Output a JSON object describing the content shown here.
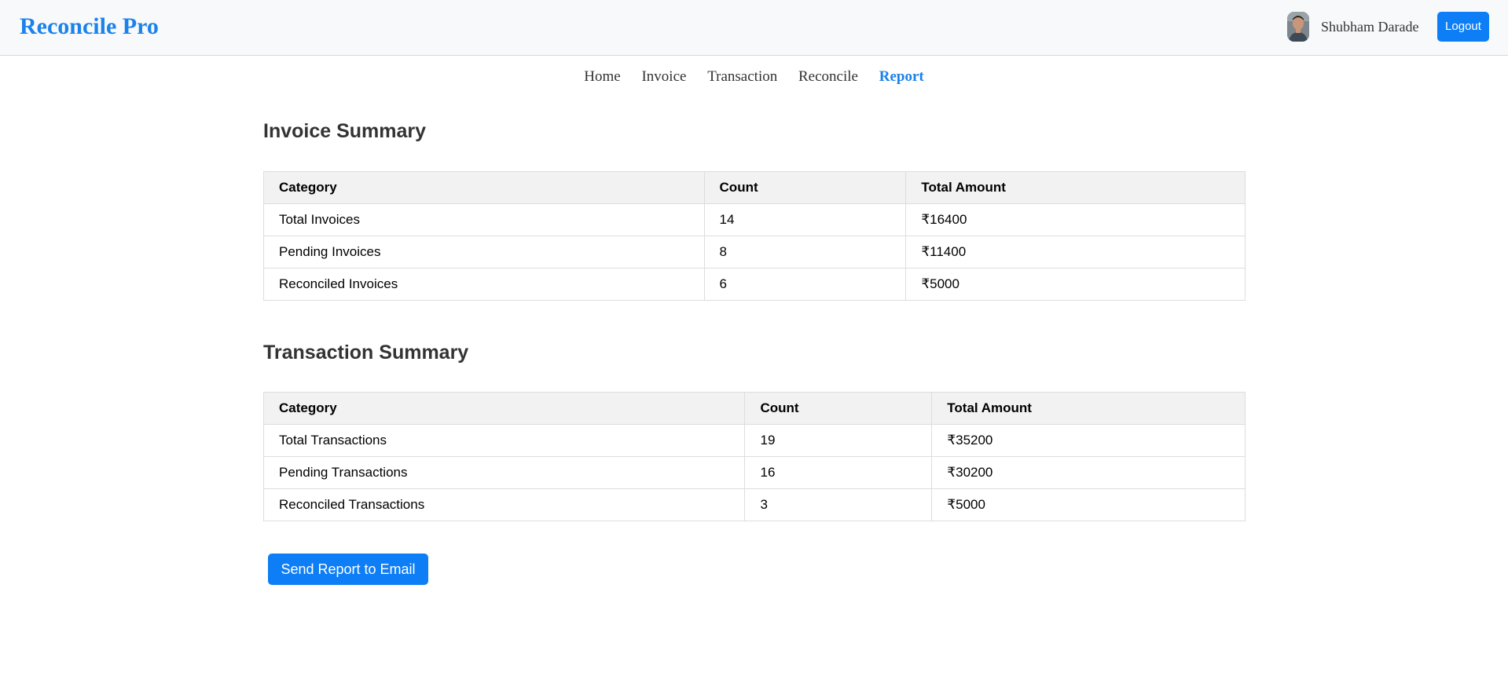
{
  "header": {
    "brand": "Reconcile Pro",
    "user_name": "Shubham Darade",
    "logout_label": "Logout",
    "avatar_icon": "user-photo-avatar"
  },
  "nav": {
    "items": [
      {
        "label": "Home",
        "active": false
      },
      {
        "label": "Invoice",
        "active": false
      },
      {
        "label": "Transaction",
        "active": false
      },
      {
        "label": "Reconcile",
        "active": false
      },
      {
        "label": "Report",
        "active": true
      }
    ]
  },
  "invoice_summary": {
    "title": "Invoice Summary",
    "columns": [
      "Category",
      "Count",
      "Total Amount"
    ],
    "rows": [
      {
        "category": "Total Invoices",
        "count": "14",
        "amount": "₹16400"
      },
      {
        "category": "Pending Invoices",
        "count": "8",
        "amount": "₹11400"
      },
      {
        "category": "Reconciled Invoices",
        "count": "6",
        "amount": "₹5000"
      }
    ]
  },
  "transaction_summary": {
    "title": "Transaction Summary",
    "columns": [
      "Category",
      "Count",
      "Total Amount"
    ],
    "rows": [
      {
        "category": "Total Transactions",
        "count": "19",
        "amount": "₹35200"
      },
      {
        "category": "Pending Transactions",
        "count": "16",
        "amount": "₹30200"
      },
      {
        "category": "Reconciled Transactions",
        "count": "3",
        "amount": "₹5000"
      }
    ]
  },
  "actions": {
    "send_report_label": "Send Report to Email"
  },
  "colors": {
    "accent": "#1a82eb",
    "button": "#0d7ef5",
    "header_bg": "#f8f9fa",
    "table_header_bg": "#f2f2f2"
  }
}
